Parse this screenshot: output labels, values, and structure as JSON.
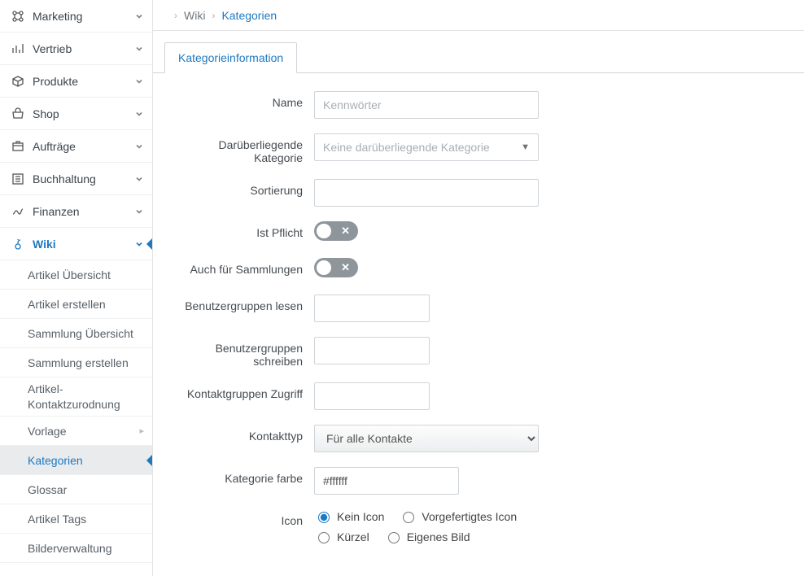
{
  "sidebar": {
    "items": [
      {
        "label": "Marketing",
        "icon": "marketing-icon"
      },
      {
        "label": "Vertrieb",
        "icon": "sales-icon"
      },
      {
        "label": "Produkte",
        "icon": "products-icon"
      },
      {
        "label": "Shop",
        "icon": "shop-icon"
      },
      {
        "label": "Aufträge",
        "icon": "orders-icon"
      },
      {
        "label": "Buchhaltung",
        "icon": "accounting-icon"
      },
      {
        "label": "Finanzen",
        "icon": "finance-icon"
      },
      {
        "label": "Wiki",
        "icon": "wiki-icon",
        "active": true
      }
    ],
    "sub": [
      "Artikel Übersicht",
      "Artikel erstellen",
      "Sammlung Übersicht",
      "Sammlung erstellen",
      "Artikel-Kontaktzurodnung",
      "Vorlage",
      "Kategorien",
      "Glossar",
      "Artikel Tags",
      "Bilderverwaltung"
    ],
    "sub_selected_index": 6,
    "sub_with_chevron_index": 5
  },
  "breadcrumb": {
    "parent": "Wiki",
    "current": "Kategorien"
  },
  "tab": {
    "label": "Kategorieinformation"
  },
  "form": {
    "name": {
      "label": "Name",
      "placeholder": "Kennwörter",
      "value": ""
    },
    "parent_cat": {
      "label": "Darüberliegende Kategorie",
      "placeholder": "Keine darüberliegende Kategorie"
    },
    "sort": {
      "label": "Sortierung",
      "value": ""
    },
    "mandatory": {
      "label": "Ist Pflicht",
      "value": false
    },
    "collections": {
      "label": "Auch für Sammlungen",
      "value": false
    },
    "groups_read": {
      "label": "Benutzergruppen lesen",
      "value": ""
    },
    "groups_write": {
      "label": "Benutzergruppen schreiben",
      "value": ""
    },
    "contact_groups": {
      "label": "Kontaktgruppen Zugriff",
      "value": ""
    },
    "contact_type": {
      "label": "Kontakttyp",
      "selected": "Für alle Kontakte"
    },
    "color": {
      "label": "Kategorie farbe",
      "value": "#ffffff"
    },
    "icon": {
      "label": "Icon",
      "options": [
        "Kein Icon",
        "Vorgefertigtes Icon",
        "Kürzel",
        "Eigenes Bild"
      ],
      "selected_index": 0
    }
  }
}
